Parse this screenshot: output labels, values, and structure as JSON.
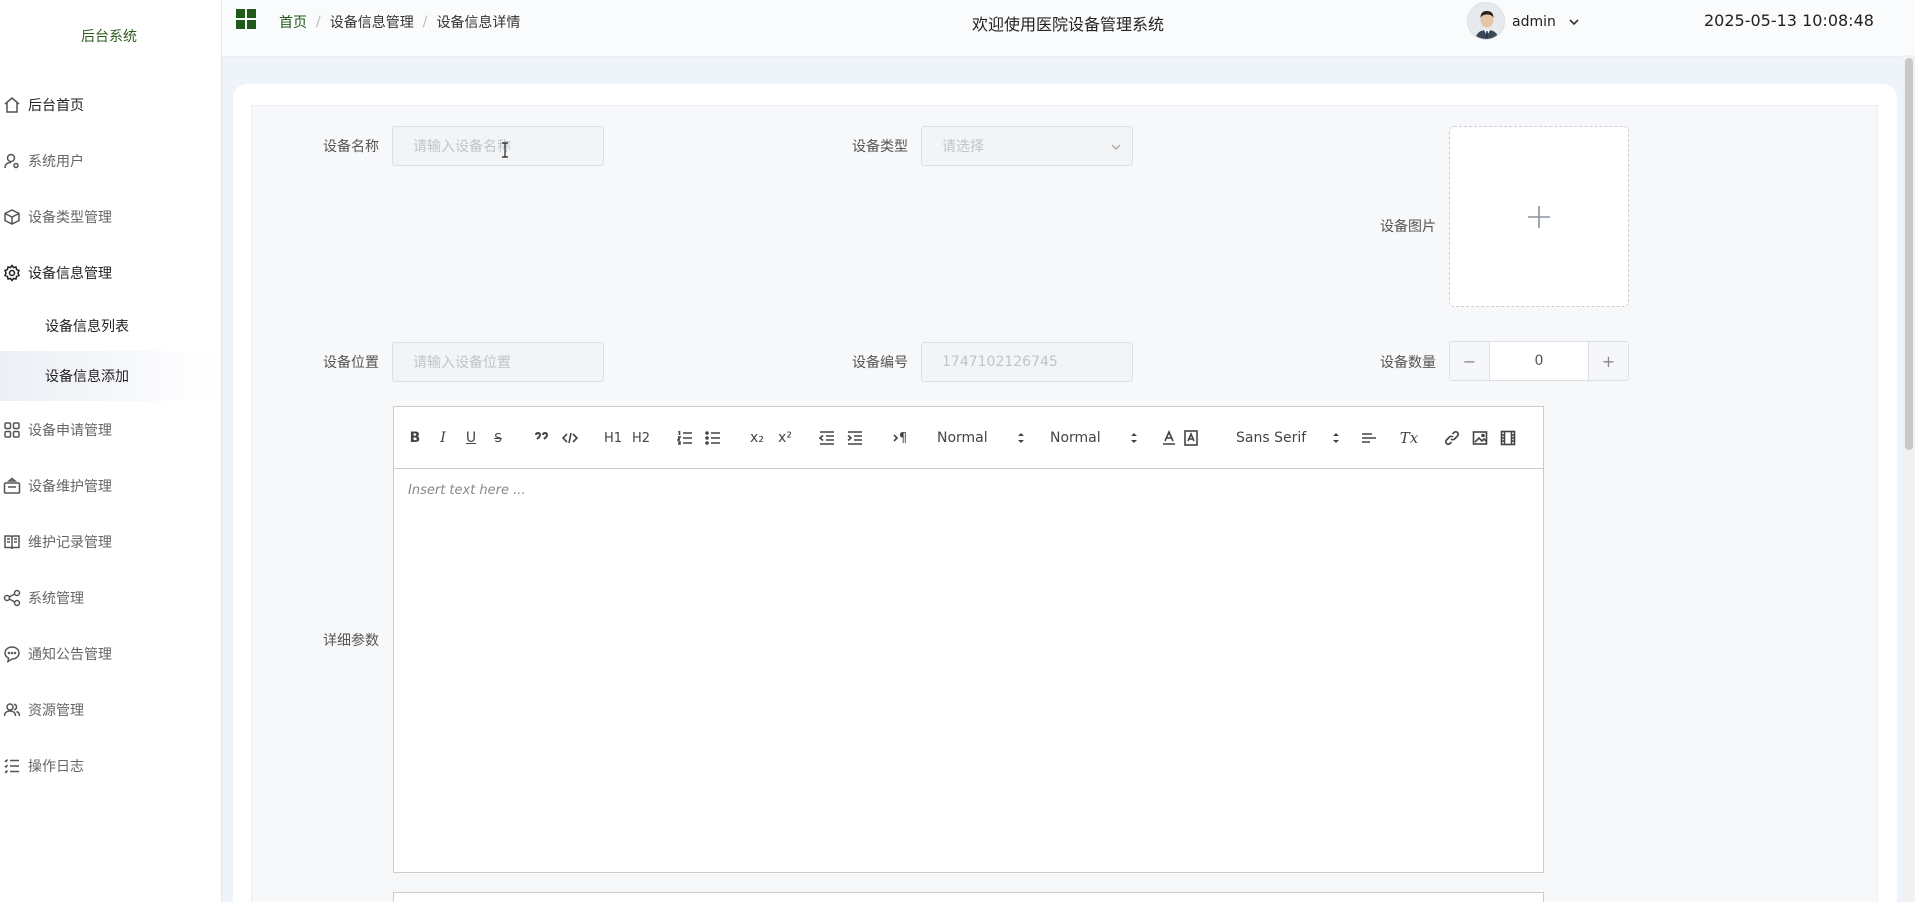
{
  "sidebar": {
    "brand": "后台系统",
    "items": [
      {
        "label": "后台首页",
        "icon": "home-icon"
      },
      {
        "label": "系统用户",
        "icon": "user-gear-icon"
      },
      {
        "label": "设备类型管理",
        "icon": "cube-icon"
      },
      {
        "label": "设备信息管理",
        "icon": "gear-icon"
      },
      {
        "label": "设备申请管理",
        "icon": "grid-icon"
      },
      {
        "label": "设备维护管理",
        "icon": "briefcase-icon"
      },
      {
        "label": "维护记录管理",
        "icon": "book-icon"
      },
      {
        "label": "系统管理",
        "icon": "share-icon"
      },
      {
        "label": "通知公告管理",
        "icon": "chat-icon"
      },
      {
        "label": "资源管理",
        "icon": "users-icon"
      },
      {
        "label": "操作日志",
        "icon": "list-icon"
      }
    ],
    "submenu": [
      {
        "label": "设备信息列表"
      },
      {
        "label": "设备信息添加"
      }
    ]
  },
  "header": {
    "breadcrumb": [
      "首页",
      "设备信息管理",
      "设备信息详情"
    ],
    "breadcrumb_sep": "/",
    "welcome": "欢迎使用医院设备管理系统",
    "username": "admin",
    "datetime": "2025-05-13 10:08:48",
    "accent": "#1f5a18"
  },
  "form": {
    "name_label": "设备名称",
    "name_placeholder": "请输入设备名称",
    "type_label": "设备类型",
    "type_placeholder": "请选择",
    "image_label": "设备图片",
    "image_upload_symbol": "+",
    "location_label": "设备位置",
    "location_placeholder": "请输入设备位置",
    "code_label": "设备编号",
    "code_value": "1747102126745",
    "qty_label": "设备数量",
    "qty_minus": "−",
    "qty_value": "0",
    "qty_plus": "+",
    "detail_label": "详细参数"
  },
  "editor": {
    "placeholder": "Insert text here ...",
    "toolbar": {
      "bold": "B",
      "italic": "I",
      "underline": "U",
      "strike": "S",
      "h1": "H1",
      "h2": "H2",
      "header_select": "Normal",
      "size_select": "Normal",
      "font_select": "Sans Serif",
      "subscript": "x₂",
      "superscript": "x²",
      "rtl": "¶",
      "clean": "Tx"
    }
  }
}
